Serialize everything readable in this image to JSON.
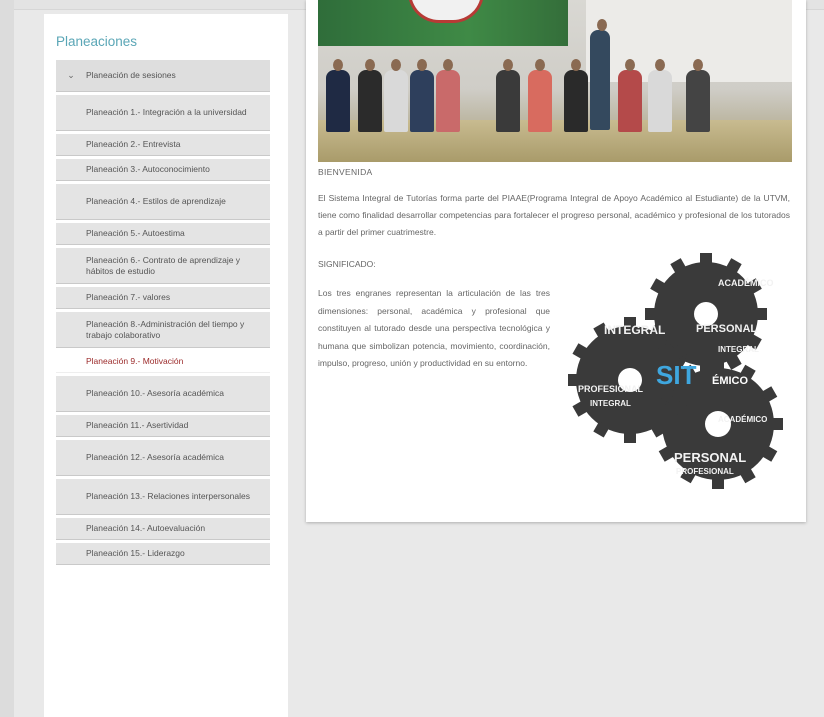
{
  "sidebar": {
    "title": "Planeaciones",
    "section_label": "Planeación de sesiones",
    "items": [
      {
        "label": "Planeación 1.- Integración a la universidad",
        "active": false
      },
      {
        "label": "Planeación 2.- Entrevista",
        "active": false
      },
      {
        "label": "Planeación 3.- Autoconocimiento",
        "active": false
      },
      {
        "label": "Planeación 4.- Estilos de aprendizaje",
        "active": false
      },
      {
        "label": "Planeación 5.- Autoestima",
        "active": false
      },
      {
        "label": "Planeación 6.- Contrato de aprendizaje y hábitos de estudio",
        "active": false
      },
      {
        "label": "Planeación 7.- valores",
        "active": false
      },
      {
        "label": "Planeación 8.-Administración del tiempo y trabajo colaborativo",
        "active": false
      },
      {
        "label": "Planeación 9.- Motivación",
        "active": true
      },
      {
        "label": "Planeación 10.- Asesoría académica",
        "active": false
      },
      {
        "label": "Planeación 11.- Asertividad",
        "active": false
      },
      {
        "label": "Planeación 12.- Asesoría académica",
        "active": false
      },
      {
        "label": "Planeación 13.- Relaciones interpersonales",
        "active": false
      },
      {
        "label": "Planeación 14.- Autoevaluación",
        "active": false
      },
      {
        "label": "Planeación 15.- Liderazgo",
        "active": false
      }
    ]
  },
  "main": {
    "welcome_title": "BIENVENIDA",
    "welcome_text": "El Sistema Integral de Tutorías forma parte del PIAAE(Programa Integral de Apoyo Académico al Estudiante) de la UTVM, tiene como finalidad desarrollar competencias para fortalecer el progreso personal, académico y profesional de los tutorados a partir del primer cuatrimestre.",
    "meaning_title": "SIGNIFICADO:",
    "meaning_text": "Los tres engranes representan la articulación de las tres dimensiones: personal, académica y profesional que constituyen al tutorado desde una perspectiva tecnológica y humana que simbolizan potencia, movimiento, coordinación, impulso, progreso, unión y productividad en su entorno."
  },
  "wordcloud": {
    "center_word_a": "SIT",
    "center_word_b": "ÉMICO",
    "words": [
      "INTEGRAL",
      "PERSONAL",
      "ACADÉMICO",
      "PROFESIONAL",
      "INTEGRAL",
      "PERSONAL",
      "PROFESIONAL",
      "ACADÉMICO",
      "INTEGRAL"
    ]
  },
  "colors": {
    "accent_teal": "#5aa6b6",
    "active_red": "#9b2a2a",
    "sit_blue": "#3fa7df"
  }
}
